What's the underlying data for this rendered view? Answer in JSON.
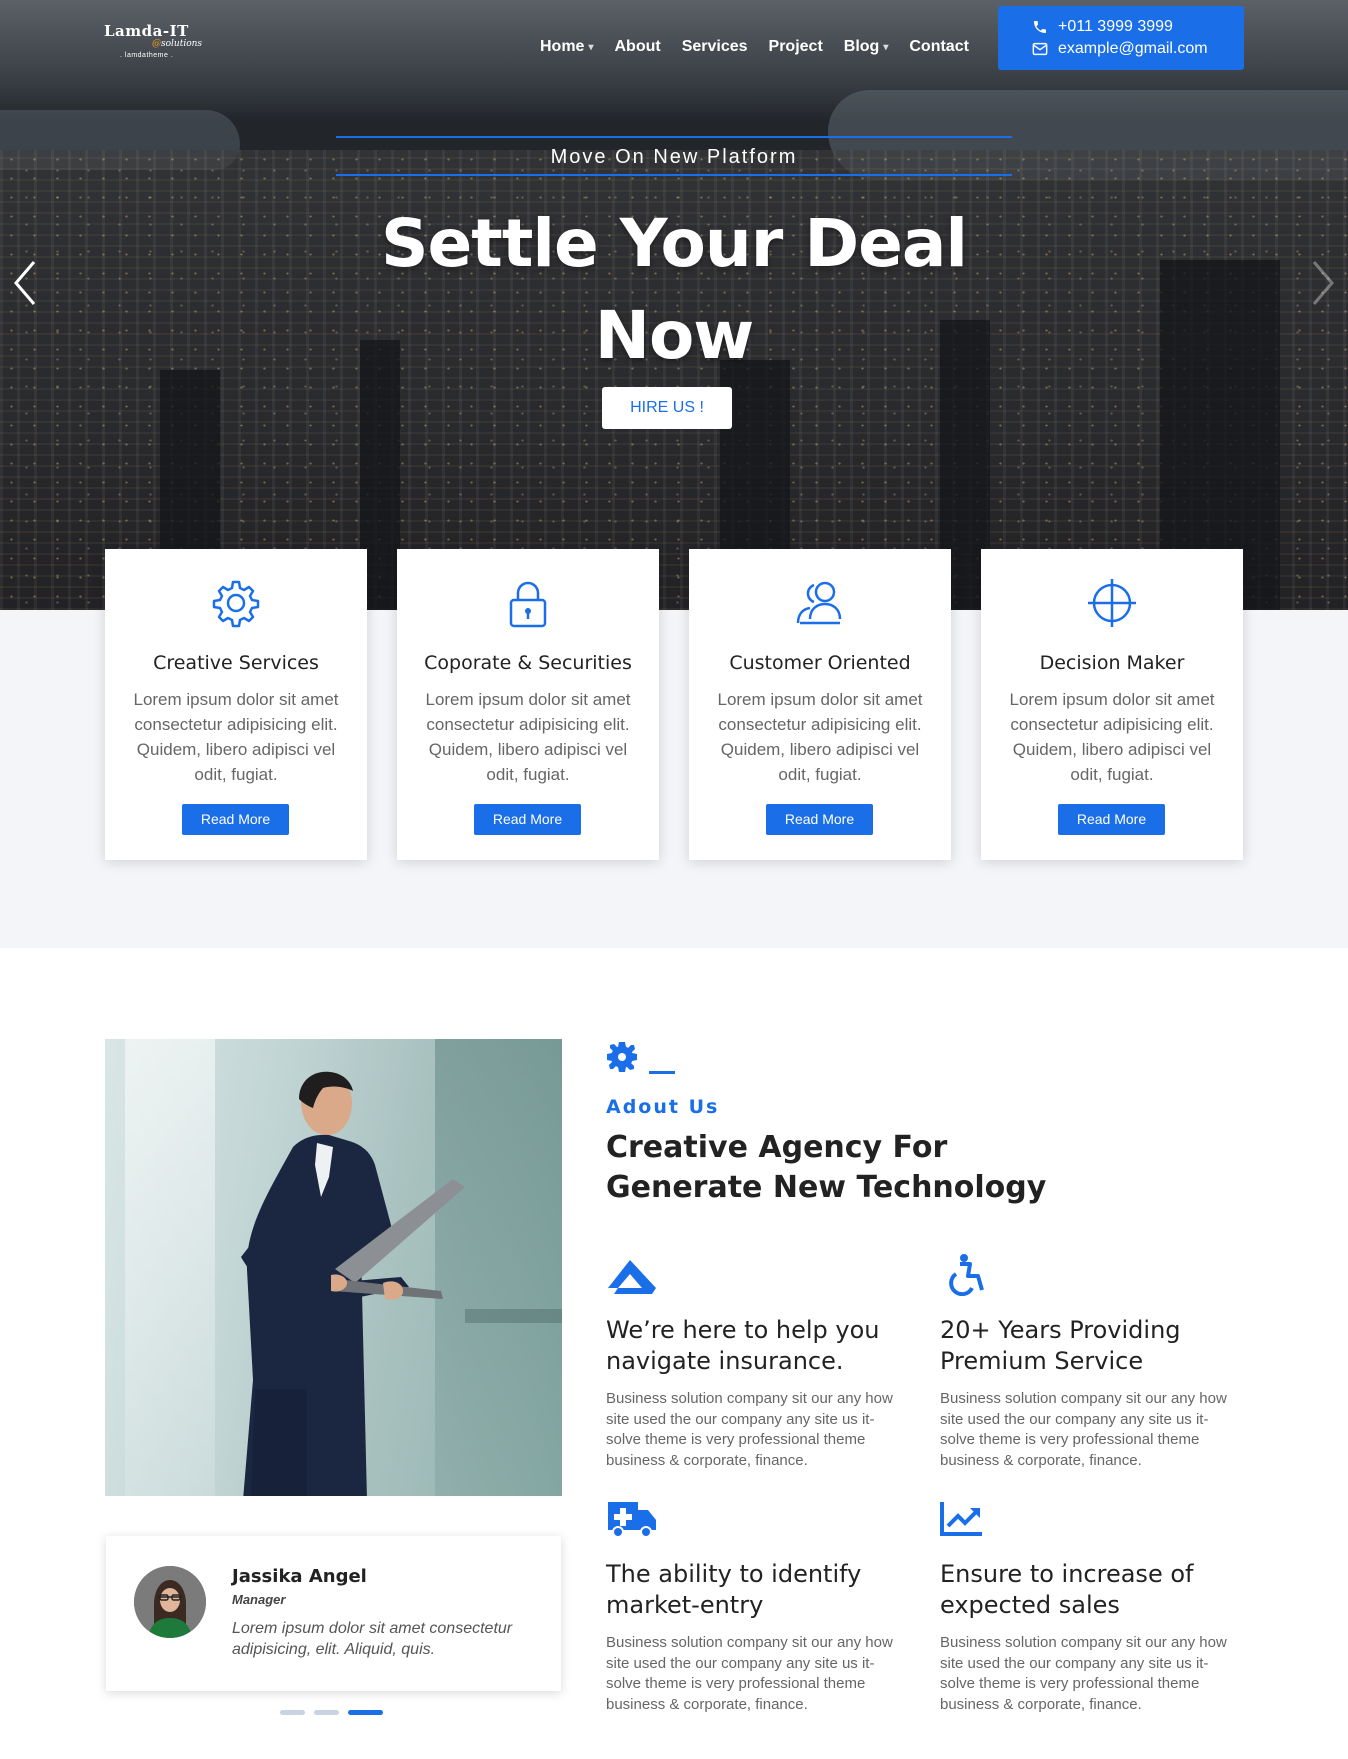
{
  "brand": {
    "logo_line1": "Lamda-IT",
    "logo_line2": "solutions",
    "logo_line3": ". lamdatheme .",
    "accent_color": "#1a6ee8"
  },
  "nav": {
    "items": [
      {
        "label": "Home",
        "has_dropdown": true
      },
      {
        "label": "About",
        "has_dropdown": false
      },
      {
        "label": "Services",
        "has_dropdown": false
      },
      {
        "label": "Project",
        "has_dropdown": false
      },
      {
        "label": "Blog",
        "has_dropdown": true
      },
      {
        "label": "Contact",
        "has_dropdown": false
      }
    ]
  },
  "contact": {
    "phone": "+011 3999 3999",
    "email": "example@gmail.com",
    "phone_icon": "phone-icon",
    "email_icon": "envelope-icon"
  },
  "hero": {
    "tagline": "Move On New Platform",
    "headline_line1": "Settle Your Deal",
    "headline_line2": "Now",
    "cta": "HIRE US !",
    "prev_icon": "chevron-left-icon",
    "next_icon": "chevron-right-icon"
  },
  "services": [
    {
      "icon": "gear-icon",
      "title": "Creative Services",
      "text": "Lorem ipsum dolor sit amet consectetur adipisicing elit. Quidem, libero adipisci vel odit, fugiat.",
      "button": "Read More"
    },
    {
      "icon": "lock-icon",
      "title": "Coporate & Securities",
      "text": "Lorem ipsum dolor sit amet consectetur adipisicing elit. Quidem, libero adipisci vel odit, fugiat.",
      "button": "Read More"
    },
    {
      "icon": "users-icon",
      "title": "Customer Oriented",
      "text": "Lorem ipsum dolor sit amet consectetur adipisicing elit. Quidem, libero adipisci vel odit, fugiat.",
      "button": "Read More"
    },
    {
      "icon": "crosshair-icon",
      "title": "Decision Maker",
      "text": "Lorem ipsum dolor sit amet consectetur adipisicing elit. Quidem, libero adipisci vel odit, fugiat.",
      "button": "Read More"
    }
  ],
  "about": {
    "label": "Adout Us",
    "title": "Creative Agency For Generate New Technology",
    "features": [
      {
        "icon": "navigate-icon",
        "title": "We’re here to help you navigate insurance.",
        "text": "Business solution company sit our any how site used the our company any site us it-solve theme is very professional theme business & corporate, finance."
      },
      {
        "icon": "accessibility-icon",
        "title": "20+ Years Providing Premium Service",
        "text": "Business solution company sit our any how site used the our company any site us it-solve theme is very professional theme business & corporate, finance."
      },
      {
        "icon": "ambulance-icon",
        "title": "The ability to identify market-entry",
        "text": "Business solution company sit our any how site used the our company any site us it-solve theme is very professional theme business & corporate, finance."
      },
      {
        "icon": "chart-line-icon",
        "title": "Ensure to increase of expected sales",
        "text": "Business solution company sit our any how site used the our company any site us it-solve theme is very professional theme business & corporate, finance."
      }
    ]
  },
  "testimonial": {
    "name": "Jassika Angel",
    "role": "Manager",
    "text": "Lorem ipsum dolor sit amet consectetur adipisicing, elit. Aliquid, quis."
  },
  "carousel": {
    "count": 3,
    "active_index": 2
  }
}
